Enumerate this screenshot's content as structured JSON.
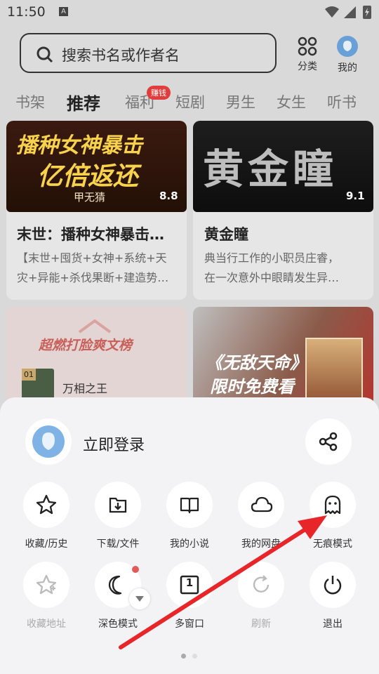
{
  "status_bar": {
    "time": "11:50",
    "a_icon": "A"
  },
  "search": {
    "placeholder": "搜索书名或作者名"
  },
  "header_actions": {
    "category_label": "分类",
    "mine_label": "我的"
  },
  "tabs": [
    {
      "label": "书架",
      "active": false
    },
    {
      "label": "推荐",
      "active": true
    },
    {
      "label": "福利",
      "active": false,
      "badge": "赚钱"
    },
    {
      "label": "短剧",
      "active": false
    },
    {
      "label": "男生",
      "active": false
    },
    {
      "label": "女生",
      "active": false
    },
    {
      "label": "听书",
      "active": false
    }
  ],
  "books": [
    {
      "cover_title_line1": "播种女神暴击",
      "cover_title_line2": "亿倍返还",
      "cover_author": "甲无猜",
      "rating": "8.8",
      "title": "末世：播种女神暴击…",
      "desc_line1": "【末世+囤货+女神+系统+天",
      "desc_line2": "灾+异能+杀伐果断+建造势…"
    },
    {
      "cover_title": "黄金瞳",
      "rating": "9.1",
      "title": "黄金瞳",
      "desc_line1": "典当行工作的小职员庄睿，",
      "desc_line2": "在一次意外中眼睛发生异…"
    }
  ],
  "ranking": {
    "title": "超燃打脸爽文榜",
    "rank": "01",
    "book": "万相之王"
  },
  "promo": {
    "line1": "《无敌天命》",
    "line2": "限时免费看"
  },
  "sheet": {
    "login_label": "立即登录",
    "row1": [
      {
        "label": "收藏/历史",
        "icon": "star-icon"
      },
      {
        "label": "下载/文件",
        "icon": "download-folder-icon"
      },
      {
        "label": "我的小说",
        "icon": "book-icon"
      },
      {
        "label": "我的网盘",
        "icon": "cloud-icon"
      },
      {
        "label": "无痕模式",
        "icon": "ghost-icon"
      }
    ],
    "row2": [
      {
        "label": "收藏地址",
        "icon": "star-add-icon",
        "disabled": true
      },
      {
        "label": "深色模式",
        "icon": "moon-icon",
        "disabled": false
      },
      {
        "label": "多窗口",
        "icon": "window-count-icon",
        "window_count": "1",
        "disabled": false
      },
      {
        "label": "刷新",
        "icon": "refresh-icon",
        "disabled": true
      },
      {
        "label": "退出",
        "icon": "power-icon",
        "disabled": false
      }
    ]
  },
  "colors": {
    "accent_red": "#e23d3d",
    "sheet_bg": "#f3f3f5",
    "page_dim": "#d9d9d9"
  }
}
